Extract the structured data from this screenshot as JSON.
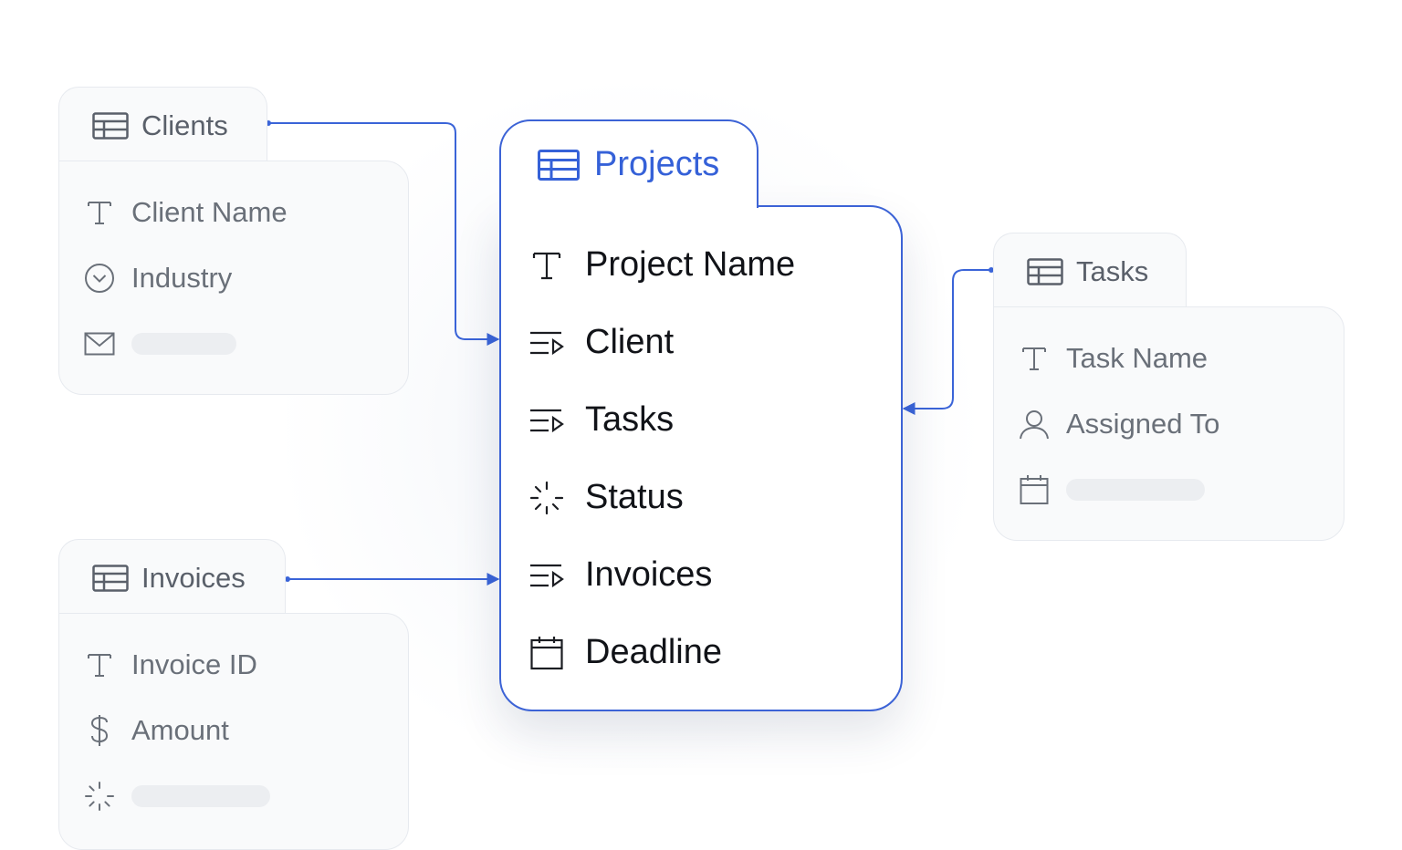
{
  "center_table": {
    "title": "Projects",
    "fields": [
      {
        "label": "Project Name",
        "icon": "text-type-icon"
      },
      {
        "label": "Client",
        "icon": "linked-record-icon"
      },
      {
        "label": "Tasks",
        "icon": "linked-record-icon"
      },
      {
        "label": "Status",
        "icon": "status-loader-icon"
      },
      {
        "label": "Invoices",
        "icon": "linked-record-icon"
      },
      {
        "label": "Deadline",
        "icon": "calendar-icon"
      }
    ]
  },
  "clients_table": {
    "title": "Clients",
    "fields": [
      {
        "label": "Client Name",
        "icon": "text-type-icon"
      },
      {
        "label": "Industry",
        "icon": "single-select-icon"
      },
      {
        "label": "",
        "icon": "email-icon"
      }
    ]
  },
  "tasks_table": {
    "title": "Tasks",
    "fields": [
      {
        "label": "Task Name",
        "icon": "text-type-icon"
      },
      {
        "label": "Assigned To",
        "icon": "user-icon"
      },
      {
        "label": "",
        "icon": "calendar-icon"
      }
    ]
  },
  "invoices_table": {
    "title": "Invoices",
    "fields": [
      {
        "label": "Invoice ID",
        "icon": "text-type-icon"
      },
      {
        "label": "Amount",
        "icon": "dollar-icon"
      },
      {
        "label": "",
        "icon": "status-loader-icon"
      }
    ]
  },
  "colors": {
    "accent": "#3561d8",
    "connector": "#3a64d8",
    "muted_text": "#6a7079",
    "card_bg": "#f9fafb",
    "card_border": "#e7eaef"
  }
}
